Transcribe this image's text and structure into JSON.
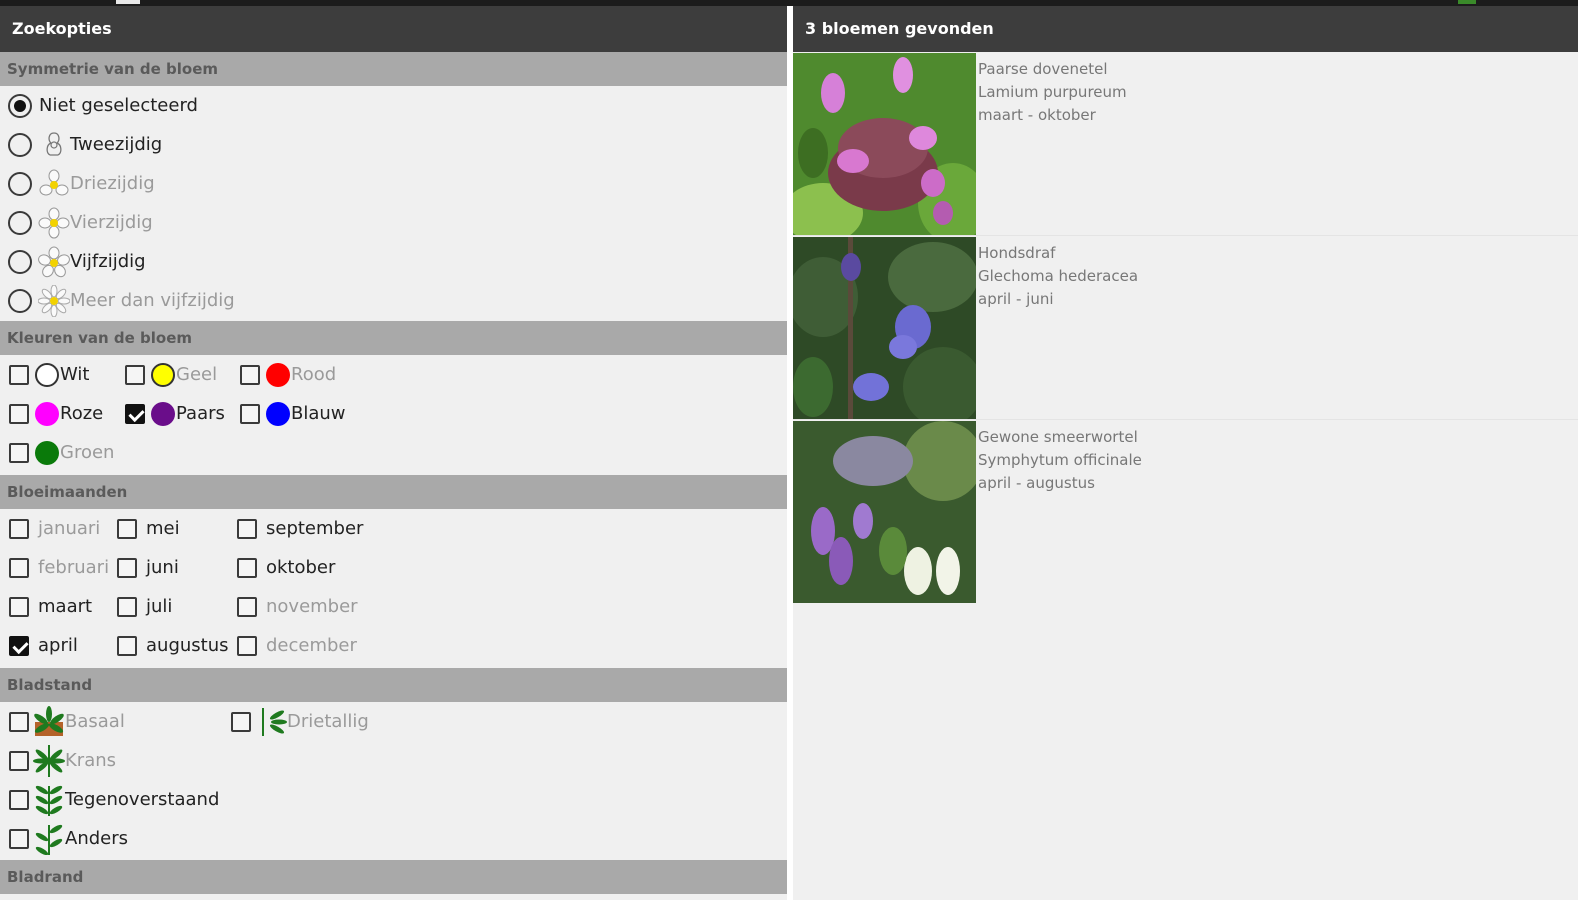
{
  "left_panel": {
    "title": "Zoekopties"
  },
  "right_panel": {
    "title": "3 bloemen gevonden"
  },
  "symmetry": {
    "header": "Symmetrie van de bloem",
    "options": [
      {
        "label": "Niet geselecteerd",
        "selected": true,
        "enabled": true,
        "icon": "none"
      },
      {
        "label": "Tweezijdig",
        "selected": false,
        "enabled": true,
        "icon": "bilateral-flower-icon"
      },
      {
        "label": "Driezijdig",
        "selected": false,
        "enabled": false,
        "icon": "three-petal-flower-icon"
      },
      {
        "label": "Vierzijdig",
        "selected": false,
        "enabled": false,
        "icon": "four-petal-flower-icon"
      },
      {
        "label": "Vijfzijdig",
        "selected": false,
        "enabled": true,
        "icon": "five-petal-flower-icon"
      },
      {
        "label": "Meer dan vijfzijdig",
        "selected": false,
        "enabled": false,
        "icon": "many-petal-flower-icon"
      }
    ]
  },
  "colors": {
    "header": "Kleuren van de bloem",
    "options": [
      {
        "label": "Wit",
        "color": "#ffffff",
        "checked": false,
        "enabled": true
      },
      {
        "label": "Geel",
        "color": "#ffff00",
        "checked": false,
        "enabled": false
      },
      {
        "label": "Rood",
        "color": "#ff0000",
        "checked": false,
        "enabled": false
      },
      {
        "label": "Roze",
        "color": "#ff00ff",
        "checked": false,
        "enabled": true
      },
      {
        "label": "Paars",
        "color": "#6a0d8a",
        "checked": true,
        "enabled": true
      },
      {
        "label": "Blauw",
        "color": "#0000ff",
        "checked": false,
        "enabled": true
      },
      {
        "label": "Groen",
        "color": "#0a7a0a",
        "checked": false,
        "enabled": false
      }
    ]
  },
  "months": {
    "header": "Bloeimaanden",
    "options": [
      {
        "label": "januari",
        "checked": false,
        "enabled": false
      },
      {
        "label": "februari",
        "checked": false,
        "enabled": false
      },
      {
        "label": "maart",
        "checked": false,
        "enabled": true
      },
      {
        "label": "april",
        "checked": true,
        "enabled": true
      },
      {
        "label": "mei",
        "checked": false,
        "enabled": true
      },
      {
        "label": "juni",
        "checked": false,
        "enabled": true
      },
      {
        "label": "juli",
        "checked": false,
        "enabled": true
      },
      {
        "label": "augustus",
        "checked": false,
        "enabled": true
      },
      {
        "label": "september",
        "checked": false,
        "enabled": true
      },
      {
        "label": "oktober",
        "checked": false,
        "enabled": true
      },
      {
        "label": "november",
        "checked": false,
        "enabled": false
      },
      {
        "label": "december",
        "checked": false,
        "enabled": false
      }
    ]
  },
  "leaf_arrangement": {
    "header": "Bladstand",
    "options": [
      {
        "label": "Basaal",
        "checked": false,
        "enabled": false,
        "icon": "basal-leaf-icon"
      },
      {
        "label": "Drietallig",
        "checked": false,
        "enabled": false,
        "icon": "trifoliate-leaf-icon"
      },
      {
        "label": "Krans",
        "checked": false,
        "enabled": false,
        "icon": "whorl-leaf-icon"
      },
      {
        "label": "Tegenoverstaand",
        "checked": false,
        "enabled": true,
        "icon": "opposite-leaf-icon"
      },
      {
        "label": "Anders",
        "checked": false,
        "enabled": true,
        "icon": "alternate-leaf-icon"
      }
    ]
  },
  "leaf_margin": {
    "header": "Bladrand"
  },
  "results": [
    {
      "name": "Paarse dovenetel",
      "latin": "Lamium purpureum",
      "period": "maart - oktober",
      "photo": "purple-deadnettle-photo"
    },
    {
      "name": "Hondsdraf",
      "latin": "Glechoma hederacea",
      "period": "april - juni",
      "photo": "ground-ivy-photo"
    },
    {
      "name": "Gewone smeerwortel",
      "latin": "Symphytum officinale",
      "period": "april - augustus",
      "photo": "comfrey-photo"
    }
  ]
}
